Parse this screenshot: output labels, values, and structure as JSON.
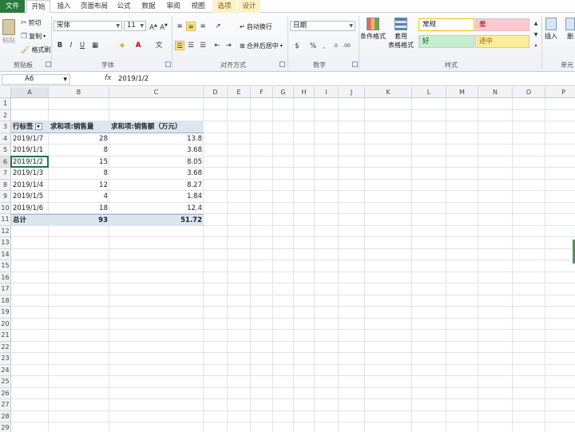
{
  "tabs": [
    "文件",
    "开始",
    "插入",
    "页面布局",
    "公式",
    "数据",
    "审阅",
    "视图",
    "选项",
    "设计"
  ],
  "clipboard": {
    "paste": "粘贴",
    "cut": "剪切",
    "copy": "复制",
    "format_painter": "格式刷",
    "label": "剪贴板"
  },
  "font": {
    "name": "宋体",
    "size": "11",
    "bold": "B",
    "italic": "I",
    "underline": "U",
    "label": "字体"
  },
  "alignment": {
    "wrap": "自动换行",
    "merge": "合并后居中",
    "label": "对齐方式"
  },
  "number": {
    "format": "日期",
    "label": "数字"
  },
  "styles": {
    "conditional": "条件格式",
    "table_format_1": "套用",
    "table_format_2": "表格格式",
    "normal": "常规",
    "bad": "差",
    "good": "好",
    "neutral": "适中",
    "label": "样式"
  },
  "cells_group": {
    "insert": "插入",
    "delete": "删",
    "label": "单元"
  },
  "formula_bar": {
    "name_box": "A6",
    "fx": "fx",
    "content": "2019/1/2"
  },
  "columns": [
    "A",
    "B",
    "C",
    "D",
    "E",
    "F",
    "G",
    "H",
    "I",
    "J",
    "K",
    "L",
    "M",
    "N",
    "O",
    "P"
  ],
  "rows": [
    "1",
    "2",
    "3",
    "4",
    "5",
    "6",
    "7",
    "8",
    "9",
    "10",
    "11",
    "12",
    "13",
    "14",
    "15",
    "16",
    "17",
    "18",
    "19",
    "20",
    "21",
    "22",
    "23",
    "24",
    "25",
    "26",
    "27",
    "28",
    "29"
  ],
  "pivot": {
    "header": [
      "行标签",
      "求和项:销售量",
      "求和项:销售额（万元）"
    ],
    "rows": [
      [
        "2019/1/7",
        "28",
        "13.8"
      ],
      [
        "2019/1/1",
        "8",
        "3.68"
      ],
      [
        "2019/1/2",
        "15",
        "8.05"
      ],
      [
        "2019/1/3",
        "8",
        "3.68"
      ],
      [
        "2019/1/4",
        "12",
        "8.27"
      ],
      [
        "2019/1/5",
        "4",
        "1.84"
      ],
      [
        "2019/1/6",
        "18",
        "12.4"
      ]
    ],
    "total": [
      "总计",
      "93",
      "51.72"
    ]
  },
  "colors": {
    "file_tab": "#2b7a3d",
    "pivot_header": "#dce6f1",
    "bad_style": "#ffc7ce",
    "good_style": "#c6efce",
    "neutral_style": "#ffeb9c",
    "selection": "#217346"
  }
}
